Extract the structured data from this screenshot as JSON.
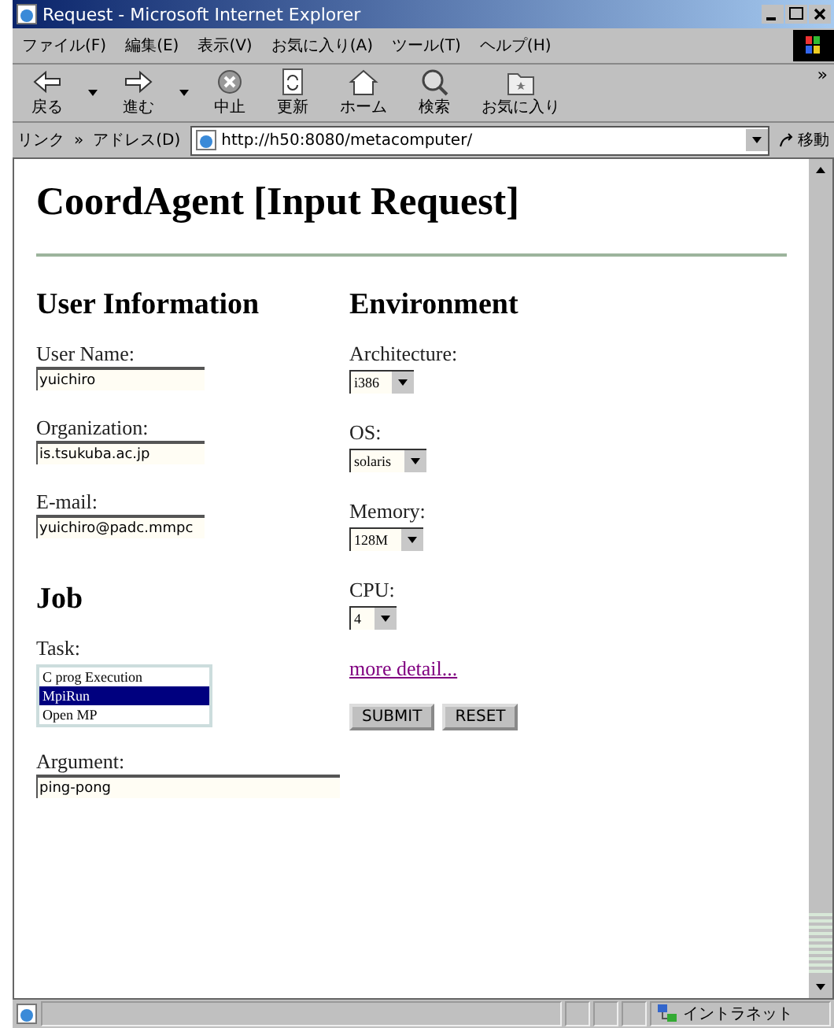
{
  "window": {
    "title": "Request - Microsoft Internet Explorer"
  },
  "menu": [
    "ファイル(F)",
    "編集(E)",
    "表示(V)",
    "お気に入り(A)",
    "ツール(T)",
    "ヘルプ(H)"
  ],
  "toolbar": [
    {
      "kind": "back",
      "label": "戻る",
      "has_menu": true
    },
    {
      "kind": "forward",
      "label": "進む",
      "has_menu": true
    },
    {
      "kind": "stop",
      "label": "中止",
      "has_menu": false
    },
    {
      "kind": "refresh",
      "label": "更新",
      "has_menu": false
    },
    {
      "kind": "home",
      "label": "ホーム",
      "has_menu": false
    },
    {
      "kind": "search",
      "label": "検索",
      "has_menu": false
    },
    {
      "kind": "favorites",
      "label": "お気に入り",
      "has_menu": false
    }
  ],
  "toolbar_more": "»",
  "address_bar": {
    "links_label": "リンク",
    "links_more": "»",
    "label": "アドレス(D)",
    "url": "http://h50:8080/metacomputer/",
    "go": "移動"
  },
  "page": {
    "heading": "CoordAgent [Input Request]",
    "user_info": {
      "heading": "User Information",
      "fields": [
        {
          "label": "User Name:",
          "value": "yuichiro"
        },
        {
          "label": "Organization:",
          "value": "is.tsukuba.ac.jp"
        },
        {
          "label": "E-mail:",
          "value": "yuichiro@padc.mmpc"
        }
      ]
    },
    "environment": {
      "heading": "Environment",
      "selects": [
        {
          "label": "Architecture:",
          "value": "i386"
        },
        {
          "label": "OS:",
          "value": "solaris"
        },
        {
          "label": "Memory:",
          "value": "128M"
        },
        {
          "label": "CPU:",
          "value": "4"
        }
      ]
    },
    "job": {
      "heading": "Job",
      "task_label": "Task:",
      "tasks": [
        {
          "label": "C prog Execution",
          "selected": false
        },
        {
          "label": "MpiRun",
          "selected": true
        },
        {
          "label": "Open MP",
          "selected": false
        }
      ],
      "argument_label": "Argument:",
      "argument": "ping-pong"
    },
    "more_link": "more detail...",
    "buttons": [
      "SUBMIT",
      "RESET"
    ]
  },
  "status_bar": {
    "zone": "イントラネット"
  }
}
